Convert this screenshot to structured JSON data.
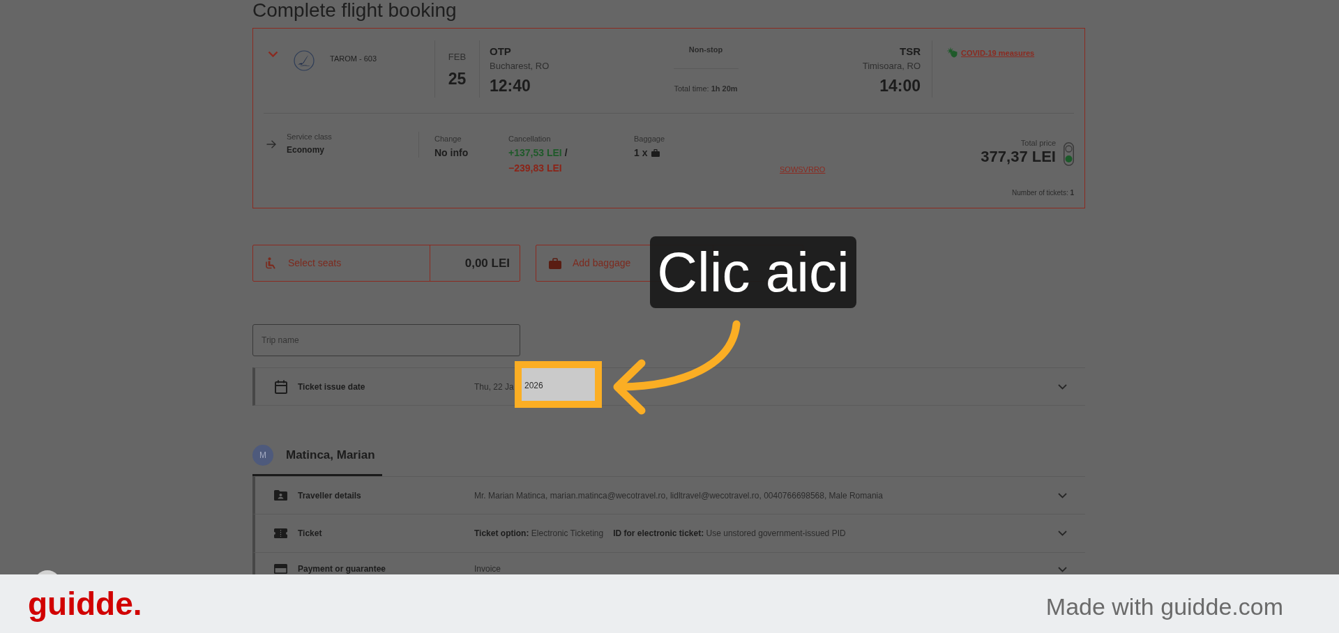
{
  "page": {
    "title": "Complete flight booking"
  },
  "flight": {
    "airline": "TAROM - 603",
    "month": "FEB",
    "day": "25",
    "departure": {
      "code": "OTP",
      "city": "Bucharest, RO",
      "time": "12:40"
    },
    "stops": "Non-stop",
    "total_time": "Total time: **1h 20m**",
    "arrival": {
      "code": "TSR",
      "city": "Timisoara, RO",
      "time": "14:00"
    },
    "covid_link": "COVID-19 measures",
    "service_class": {
      "label": "Service class",
      "value": "Economy"
    },
    "change": {
      "label": "Change",
      "value": "No info"
    },
    "cancellation": {
      "label": "Cancellation",
      "refund": "+137,53 LEI",
      "separator": "/",
      "fee": "−239,83 LEI"
    },
    "baggage": {
      "label": "Baggage",
      "value": "1 x"
    },
    "fare_code": "SOWSVRRO",
    "total_price_label": "Total price",
    "total_price": "377,37 LEI",
    "tickets": "Number of tickets: **1**"
  },
  "extras": [
    {
      "kind": "seats",
      "label": "Select seats",
      "price": "0,00 LEI"
    },
    {
      "kind": "baggage",
      "label": "Add baggage"
    }
  ],
  "trip_name": {
    "placeholder": "Trip name"
  },
  "ticket_issue_date": {
    "label": "Ticket issue date",
    "value": "Thu, 22 Ja"
  },
  "traveller": {
    "initial": "M",
    "name": "Matinca, Marian",
    "sections": [
      {
        "kind": "details",
        "label": "Traveller details",
        "values": [
          "Mr. Marian Matinca, marian.matinca@wecotravel.ro, lidltravel@wecotravel.ro, 0040766698568, Male Romania"
        ]
      },
      {
        "kind": "ticket",
        "label": "Ticket",
        "values": [
          "**Ticket option:** Electronic Ticketing",
          "**ID for electronic ticket:** Use unstored government-issued PID"
        ]
      },
      {
        "kind": "payment",
        "label": "Payment or guarantee",
        "values": [
          "Invoice"
        ]
      }
    ]
  },
  "highlight": {
    "text": "2026"
  },
  "tooltip": {
    "text": "Clic aici"
  },
  "footer": {
    "logo": "guidde.",
    "credit": "Made with guidde.com"
  }
}
